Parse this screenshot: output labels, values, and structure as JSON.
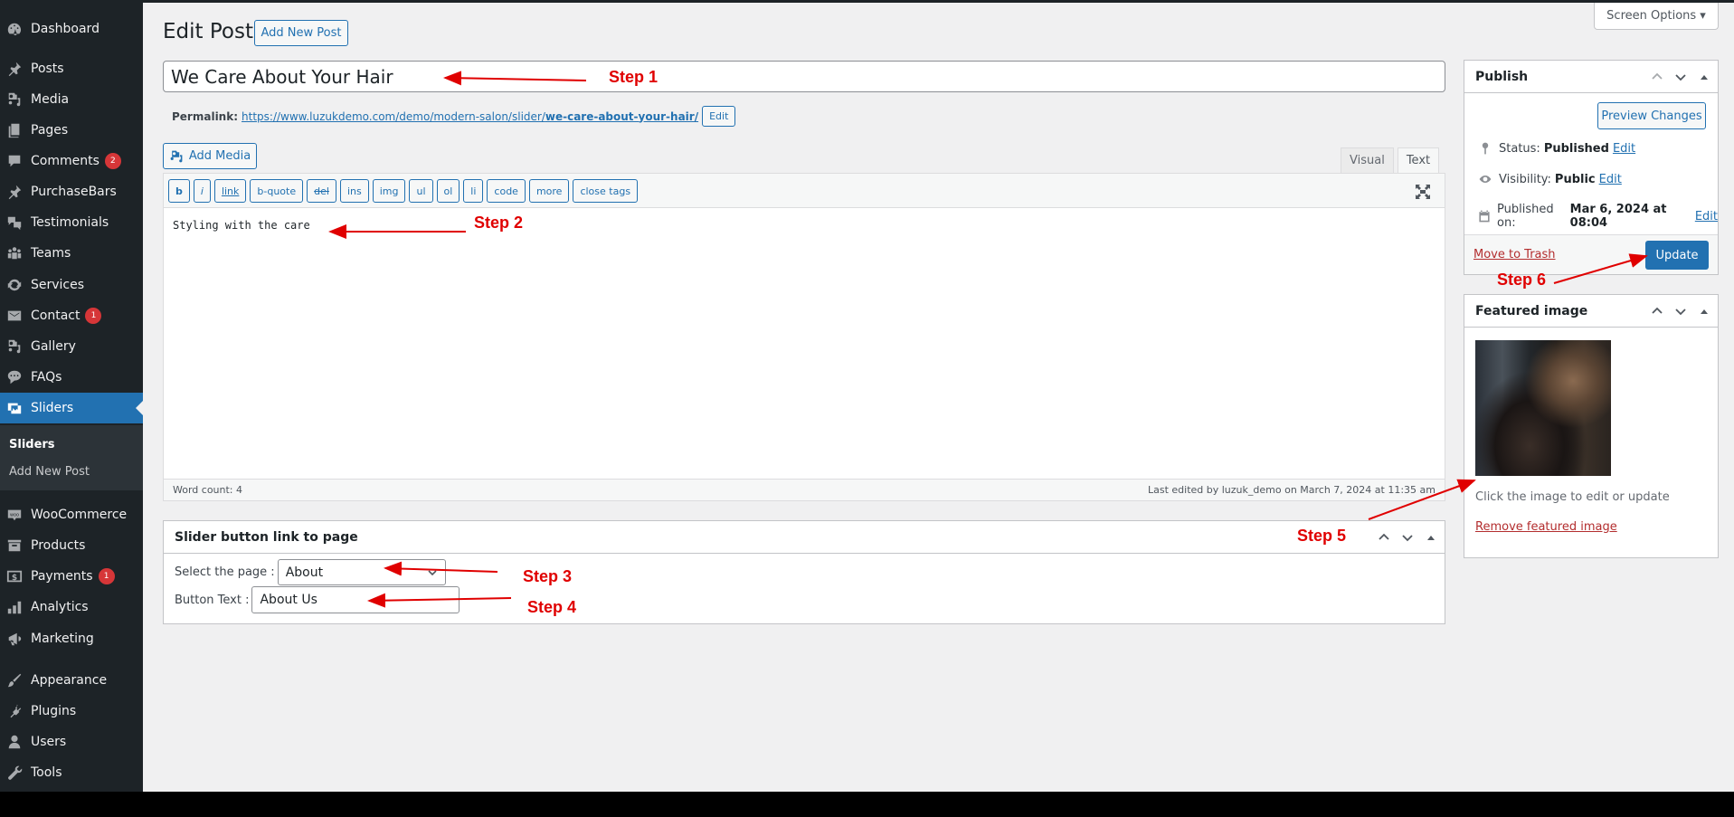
{
  "sidebar": {
    "items": [
      {
        "label": "Dashboard",
        "icon": "dashboard-icon"
      },
      {
        "label": "Posts",
        "icon": "pin-icon"
      },
      {
        "label": "Media",
        "icon": "media-icon"
      },
      {
        "label": "Pages",
        "icon": "pages-icon"
      },
      {
        "label": "Comments",
        "icon": "comment-icon",
        "badge": "2"
      },
      {
        "label": "PurchaseBars",
        "icon": "pin-icon"
      },
      {
        "label": "Testimonials",
        "icon": "testimonials-icon"
      },
      {
        "label": "Teams",
        "icon": "groups-icon"
      },
      {
        "label": "Services",
        "icon": "update-icon"
      },
      {
        "label": "Contact",
        "icon": "email-icon",
        "badge": "1"
      },
      {
        "label": "Gallery",
        "icon": "media-icon"
      },
      {
        "label": "FAQs",
        "icon": "chat-icon"
      },
      {
        "label": "Sliders",
        "icon": "slides-icon",
        "active": true
      },
      {
        "label": "WooCommerce",
        "icon": "woo-icon"
      },
      {
        "label": "Products",
        "icon": "archive-icon"
      },
      {
        "label": "Payments",
        "icon": "money-icon",
        "badge": "1"
      },
      {
        "label": "Analytics",
        "icon": "chart-icon"
      },
      {
        "label": "Marketing",
        "icon": "megaphone-icon"
      },
      {
        "label": "Appearance",
        "icon": "brush-icon"
      },
      {
        "label": "Plugins",
        "icon": "plugin-icon"
      },
      {
        "label": "Users",
        "icon": "users-icon"
      },
      {
        "label": "Tools",
        "icon": "wrench-icon"
      }
    ],
    "submenu": {
      "current": "Sliders",
      "add_new": "Add New Post"
    }
  },
  "header": {
    "title": "Edit Post",
    "add_new_label": "Add New Post",
    "screen_options_label": "Screen Options ▾"
  },
  "post": {
    "title": "We Care About Your Hair",
    "permalink_label": "Permalink:",
    "permalink_base": "https://www.luzukdemo.com/demo/modern-salon/slider/",
    "permalink_slug": "we-care-about-your-hair/",
    "permalink_edit_label": "Edit",
    "add_media_label": "Add Media",
    "tabs": {
      "visual": "Visual",
      "text": "Text",
      "active": "Text"
    },
    "quicktags": [
      "b",
      "i",
      "link",
      "b-quote",
      "del",
      "ins",
      "img",
      "ul",
      "ol",
      "li",
      "code",
      "more",
      "close tags"
    ],
    "content": "Styling with the care",
    "word_count": "Word count: 4",
    "last_edited": "Last edited by luzuk_demo on March 7, 2024 at 11:35 am"
  },
  "slider_box": {
    "title": "Slider button link to page",
    "select_label": "Select the page :",
    "select_value": "About",
    "button_text_label": "Button Text :",
    "button_text_value": "About Us"
  },
  "publish": {
    "title": "Publish",
    "preview_label": "Preview Changes",
    "status_label": "Status:",
    "status_value": "Published",
    "visibility_label": "Visibility:",
    "visibility_value": "Public",
    "published_label": "Published on:",
    "published_value": "Mar 6, 2024 at 08:04",
    "edit_label": "Edit",
    "trash_label": "Move to Trash",
    "update_label": "Update"
  },
  "featured": {
    "title": "Featured image",
    "hint": "Click the image to edit or update",
    "remove_label": "Remove featured image"
  },
  "annotations": {
    "step1": "Step 1",
    "step2": "Step 2",
    "step3": "Step 3",
    "step4": "Step 4",
    "step5": "Step 5",
    "step6": "Step 6",
    "color": "#e00000"
  }
}
